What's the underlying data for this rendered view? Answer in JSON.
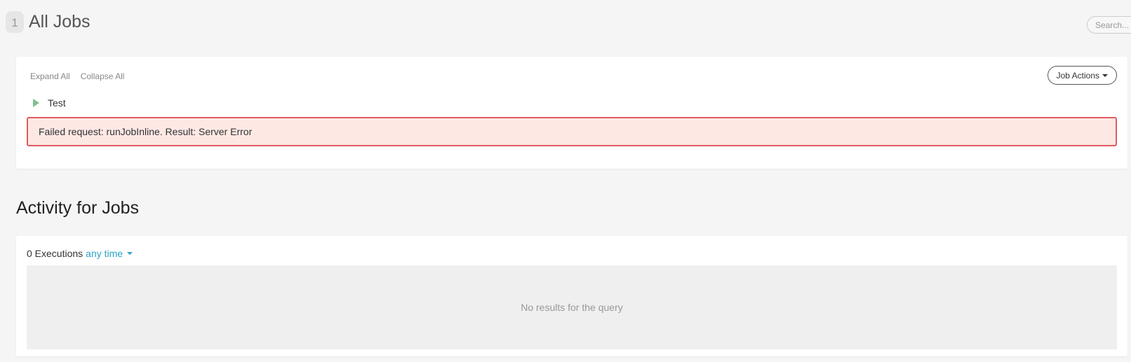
{
  "header": {
    "count": "1",
    "title": "All Jobs"
  },
  "search": {
    "placeholder": "Search..."
  },
  "jobs_panel": {
    "expand_all": "Expand All",
    "collapse_all": "Collapse All",
    "job_actions_label": "Job Actions",
    "jobs": [
      {
        "name": "Test"
      }
    ],
    "error_message": "Failed request: runJobInline. Result: Server Error"
  },
  "activity": {
    "title": "Activity for Jobs",
    "executions_label": "0 Executions",
    "time_filter": "any time",
    "empty_message": "No results for the query"
  },
  "colors": {
    "background": "#f5f5f5",
    "error_bg": "#fde8e4",
    "error_border": "#e05a60",
    "link": "#2aa3c6",
    "job_triangle": "#7fbf8f"
  }
}
